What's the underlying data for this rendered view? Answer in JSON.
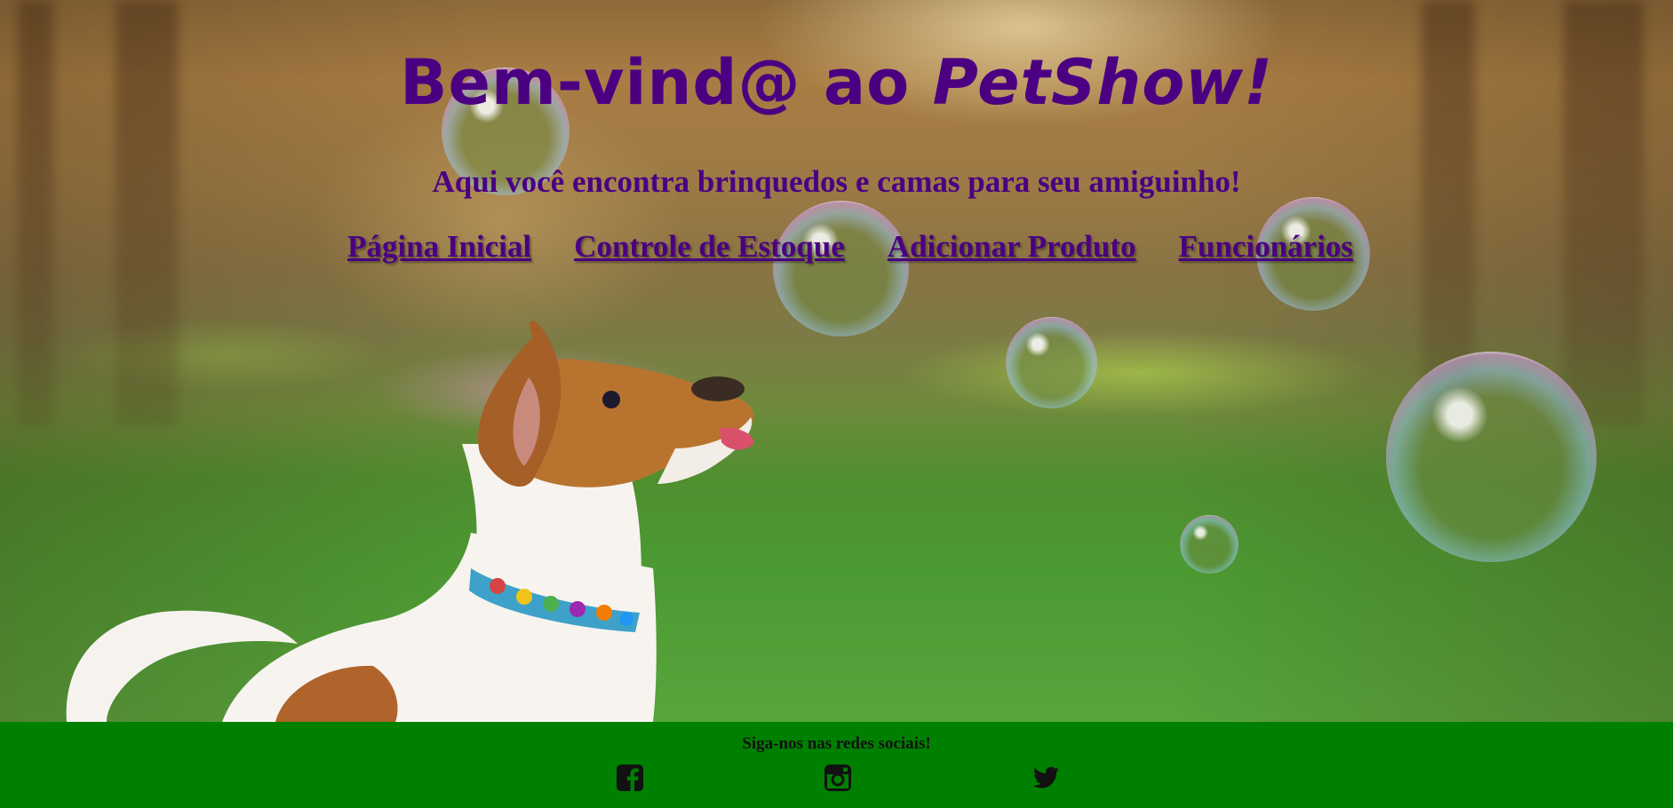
{
  "header": {
    "title_prefix": "Bem-vind@ ao ",
    "title_brand": "PetShow!",
    "subtitle": "Aqui você encontra brinquedos e camas para seu amiguinho!"
  },
  "nav": {
    "items": [
      {
        "label": "Página Inicial"
      },
      {
        "label": "Controle de Estoque"
      },
      {
        "label": "Adicionar Produto"
      },
      {
        "label": "Funcionários"
      }
    ]
  },
  "footer": {
    "text": "Siga-nos nas redes sociais!",
    "social": [
      {
        "icon": "facebook-icon"
      },
      {
        "icon": "instagram-icon"
      },
      {
        "icon": "twitter-icon"
      }
    ]
  },
  "colors": {
    "heading": "#4b0082",
    "footer_bg": "#008000",
    "footer_text": "#111111"
  }
}
